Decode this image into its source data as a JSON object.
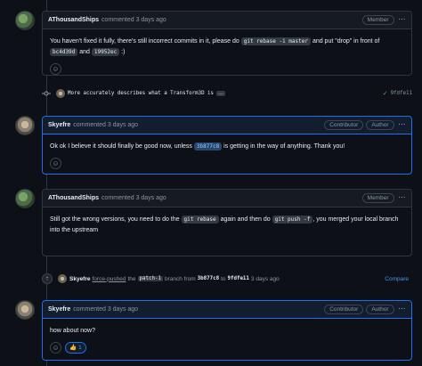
{
  "comments": [
    {
      "author": "AThousandShips",
      "when": "commented 3 days ago",
      "badges": [
        "Member"
      ],
      "body": {
        "t1": "You haven't fixed it fully, there's still incorrect commits in it, please do",
        "c1": "git rebase -i master",
        "t2": "and put \"drop\" in front of",
        "c2": "bc4d39d",
        "t3": "and",
        "c3": "19952ec",
        "t4": ":)"
      }
    },
    {
      "author": "Skyefre",
      "when": "commented 3 days ago",
      "badges": [
        "Contributor",
        "Author"
      ],
      "body": {
        "t1": "Ok ok I believe it should finally be good now, unless",
        "c1": "3b877c8",
        "t2": "is getting in the way of anything. Thank you!"
      }
    },
    {
      "author": "AThousandShips",
      "when": "commented 3 days ago",
      "badges": [
        "Member"
      ],
      "body": {
        "t1": "Still got the wrong versions, you need to do the",
        "c1": "git rebase",
        "t2": "again and then do",
        "c2": "git push -f",
        "t3": ", you merged your local branch into the upstream"
      }
    },
    {
      "author": "Skyefre",
      "when": "commented 3 days ago",
      "badges": [
        "Contributor",
        "Author"
      ],
      "body": {
        "t1": "how about now?"
      },
      "reaction": {
        "emoji": "👍",
        "count": "1"
      }
    }
  ],
  "commit_event": {
    "message": "More accurately describes what a Transform3D is",
    "more": "…",
    "sha": "9fdfe11"
  },
  "force_push_event": {
    "user": "Skyefre",
    "action": "force-pushed",
    "the": "the",
    "branch": "patch-1",
    "branch_word": "branch from",
    "from_sha": "3b877c8",
    "to": "to",
    "to_sha": "9fdfe11",
    "when": "3 days ago",
    "compare": "Compare"
  },
  "colors": {
    "accent": "#1f6feb",
    "link": "#4493f8",
    "success": "#3fb950"
  },
  "icons": {
    "kebab": "kebab-icon",
    "smiley": "smiley-icon",
    "commit": "commit-icon",
    "check": "check-icon",
    "force_push": "repo-push-icon"
  }
}
